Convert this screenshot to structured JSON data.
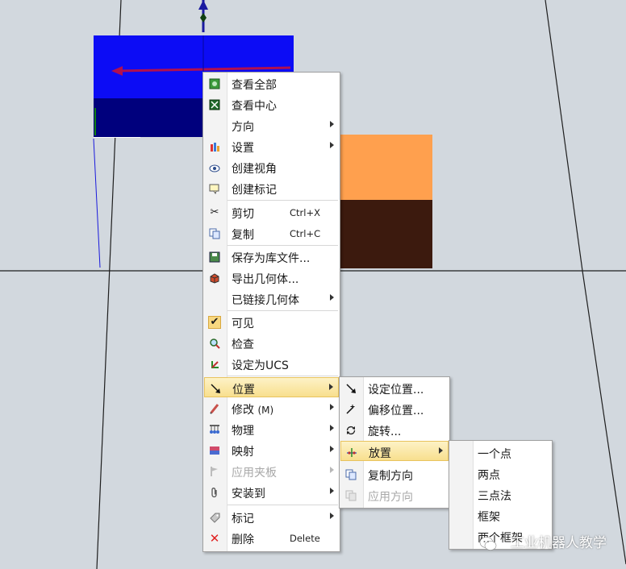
{
  "colors": {
    "accent_blue": "#0c0cf5",
    "accent_orange": "#ffa04e",
    "highlight": "#f8df8e"
  },
  "context_menu": {
    "items": [
      {
        "label": "查看全部",
        "icon": "view-all-icon"
      },
      {
        "label": "查看中心",
        "icon": "view-center-icon"
      },
      {
        "label": "方向",
        "icon": "",
        "submenu": true
      },
      {
        "label": "设置",
        "icon": "settings-icon",
        "submenu": true
      },
      {
        "label": "创建视角",
        "icon": "create-view-icon"
      },
      {
        "label": "创建标记",
        "icon": "create-tag-icon"
      },
      {
        "label": "剪切",
        "icon": "scissors-icon",
        "shortcut": "Ctrl+X"
      },
      {
        "label": "复制",
        "icon": "copy-icon",
        "shortcut": "Ctrl+C"
      },
      {
        "label": "保存为库文件...",
        "icon": "save-library-icon"
      },
      {
        "label": "导出几何体...",
        "icon": "export-geometry-icon"
      },
      {
        "label": "已链接几何体",
        "icon": "",
        "submenu": true
      },
      {
        "label": "可见",
        "icon": "check-icon",
        "checked": true
      },
      {
        "label": "检查",
        "icon": "inspect-icon"
      },
      {
        "label": "设定为UCS",
        "icon": "ucs-icon"
      },
      {
        "label": "位置",
        "icon": "position-icon",
        "submenu": true,
        "highlighted": true
      },
      {
        "label": "修改",
        "label_suffix": "(M)",
        "icon": "pencil-icon",
        "submenu": true
      },
      {
        "label": "物理",
        "icon": "physics-icon",
        "submenu": true
      },
      {
        "label": "映射",
        "icon": "mapping-icon",
        "submenu": true
      },
      {
        "label": "应用夹板",
        "icon": "flag-icon",
        "submenu": true,
        "disabled": true
      },
      {
        "label": "安装到",
        "icon": "paperclip-icon",
        "submenu": true
      },
      {
        "label": "标记",
        "icon": "tag-icon",
        "submenu": true
      },
      {
        "label": "删除",
        "icon": "delete-icon",
        "shortcut": "Delete"
      }
    ]
  },
  "position_submenu": {
    "items": [
      {
        "label": "设定位置...",
        "icon": "set-position-icon"
      },
      {
        "label": "偏移位置...",
        "icon": "offset-position-icon"
      },
      {
        "label": "旋转...",
        "icon": "rotate-icon"
      },
      {
        "label": "放置",
        "icon": "place-icon",
        "submenu": true,
        "highlighted": true
      },
      {
        "label": "复制方向",
        "icon": "copy-orientation-icon"
      },
      {
        "label": "应用方向",
        "icon": "apply-orientation-icon",
        "disabled": true
      }
    ]
  },
  "place_submenu": {
    "items": [
      {
        "label": "一个点"
      },
      {
        "label": "两点"
      },
      {
        "label": "三点法"
      },
      {
        "label": "框架"
      },
      {
        "label": "两个框架"
      }
    ]
  },
  "watermark": {
    "text": "工业机器人教学"
  }
}
